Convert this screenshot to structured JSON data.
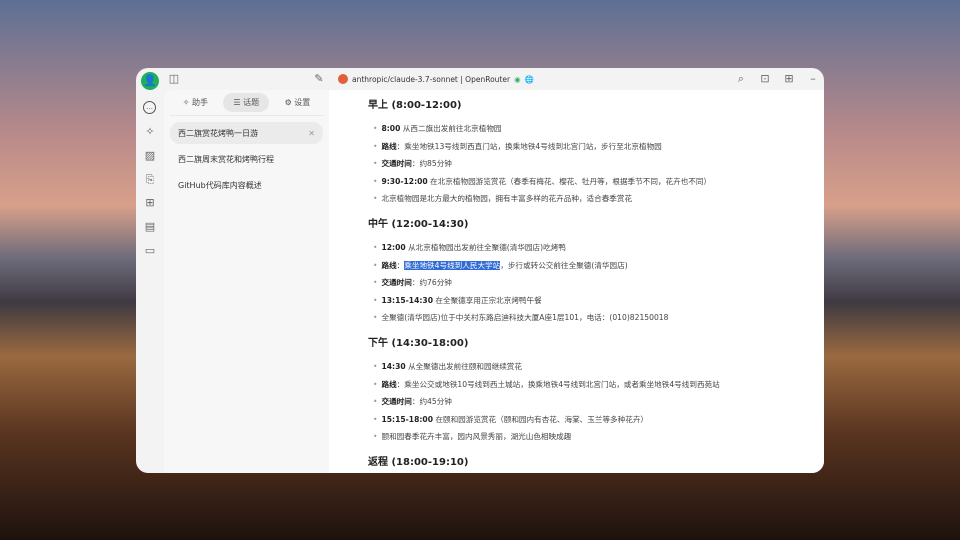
{
  "topbar": {
    "model": "anthropic/claude-3.7-sonnet | OpenRouter",
    "icons": [
      "sidebar-toggle-icon",
      "edit-icon",
      "search-icon",
      "expand-icon",
      "grid-icon",
      "minimize-icon"
    ]
  },
  "rail": {
    "icons": [
      "avatar",
      "chat-icon",
      "assistant-icon",
      "image-icon",
      "translate-icon",
      "apps-icon",
      "knowledge-icon",
      "folder-icon"
    ]
  },
  "panel": {
    "tabs": [
      {
        "label": "✧ 助手"
      },
      {
        "label": "☰ 话题"
      },
      {
        "label": "⚙ 设置"
      }
    ],
    "topics": [
      {
        "label": "西二旗赏花烤鸭一日游"
      },
      {
        "label": "西二旗周末赏花和烤鸭行程"
      },
      {
        "label": "GitHub代码库内容概述"
      }
    ]
  },
  "content": {
    "sections": [
      {
        "title": "早上 (8:00-12:00)",
        "items": [
          {
            "b": "8:00",
            "t": " 从西二旗出发前往北京植物园"
          },
          {
            "b": "路线",
            "t": "：乘坐地铁13号线到西直门站，换乘地铁4号线到北宫门站，步行至北京植物园"
          },
          {
            "b": "交通时间",
            "t": "：约85分钟"
          },
          {
            "b": "9:30-12:00",
            "t": " 在北京植物园游览赏花（春季有梅花、樱花、牡丹等，根据季节不同，花卉也不同）"
          },
          {
            "b": "",
            "t": "北京植物园是北方最大的植物园，拥有丰富多样的花卉品种，适合春季赏花"
          }
        ]
      },
      {
        "title": "中午 (12:00-14:30)",
        "items": [
          {
            "b": "12:00",
            "t": " 从北京植物园出发前往全聚德(清华园店)吃烤鸭"
          },
          {
            "b": "路线",
            "t": "：",
            "sel": "乘坐地铁4号线到人民大学站",
            "t2": "，步行或转公交前往全聚德(清华园店)"
          },
          {
            "b": "交通时间",
            "t": "：约76分钟"
          },
          {
            "b": "13:15-14:30",
            "t": " 在全聚德享用正宗北京烤鸭午餐"
          },
          {
            "b": "",
            "t": "全聚德(清华园店)位于中关村东路启迪科技大厦A座1层101，电话：(010)82150018"
          }
        ]
      },
      {
        "title": "下午 (14:30-18:00)",
        "items": [
          {
            "b": "14:30",
            "t": " 从全聚德出发前往颐和园继续赏花"
          },
          {
            "b": "路线",
            "t": "：乘坐公交或地铁10号线到西土城站，换乘地铁4号线到北宫门站，或者乘坐地铁4号线到西苑站"
          },
          {
            "b": "交通时间",
            "t": "：约45分钟"
          },
          {
            "b": "15:15-18:00",
            "t": " 在颐和园游览赏花（颐和园内有杏花、海棠、玉兰等多种花卉）"
          },
          {
            "b": "",
            "t": "颐和园春季花卉丰富，园内风景秀丽，湖光山色相映成趣"
          }
        ]
      },
      {
        "title": "返程 (18:00-19:10)",
        "items": []
      }
    ]
  }
}
